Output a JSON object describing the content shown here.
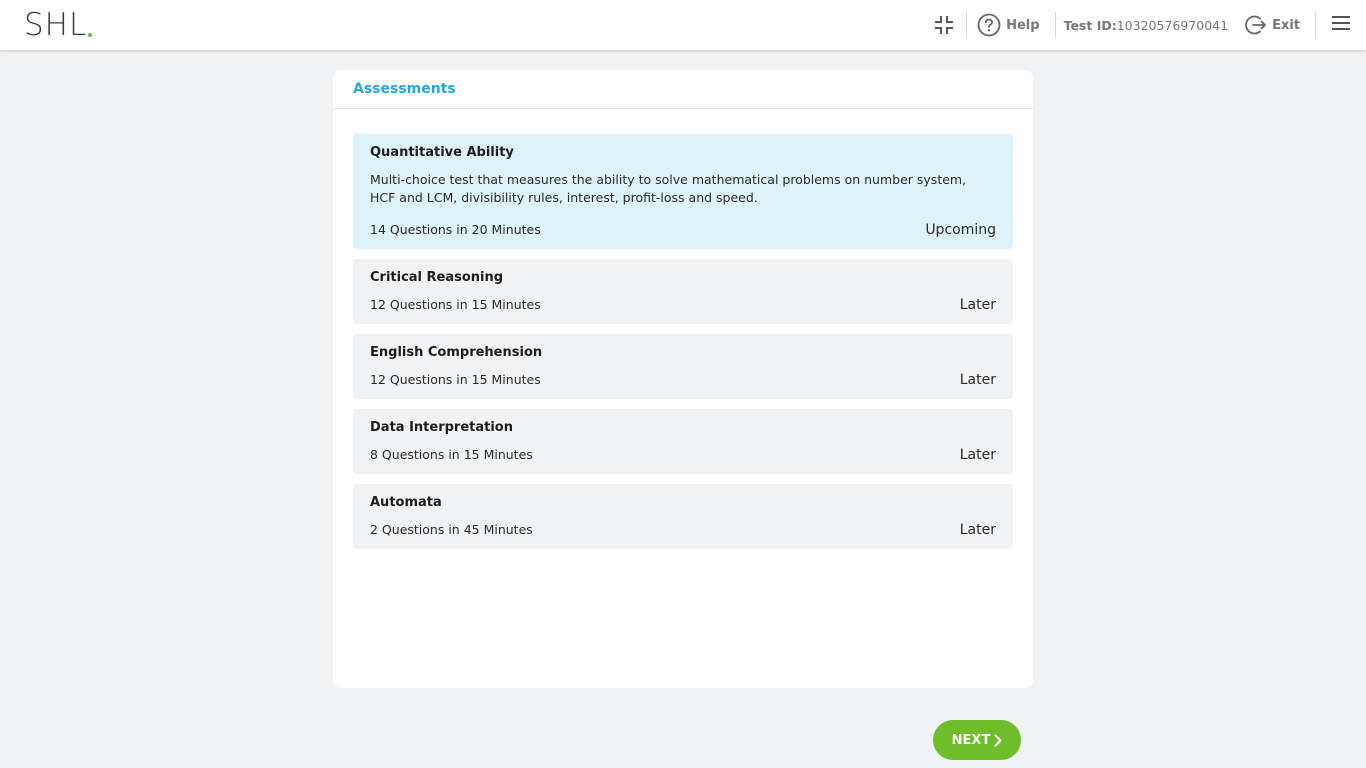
{
  "brand": {
    "logo_text": "SHL",
    "accent_color": "#6fba2c"
  },
  "header": {
    "collapse_icon": "collapse-icon",
    "help_icon": "help-circle-icon",
    "help_label": "Help",
    "test_id_label": "Test ID:",
    "test_id_value": "10320576970041",
    "exit_icon": "exit-icon",
    "exit_label": "Exit",
    "menu_icon": "hamburger-menu-icon"
  },
  "panel": {
    "title": "Assessments",
    "title_color": "#2aa6d6",
    "assessments": [
      {
        "name": "Quantitative Ability",
        "description": "Multi-choice test that measures the ability to solve mathematical problems on number system, HCF and LCM, divisibility rules, interest, profit-loss and speed.",
        "meta": "14 Questions in 20 Minutes",
        "status": "Upcoming"
      },
      {
        "name": "Critical Reasoning",
        "meta": "12 Questions in 15 Minutes",
        "status": "Later"
      },
      {
        "name": "English Comprehension",
        "meta": "12 Questions in 15 Minutes",
        "status": "Later"
      },
      {
        "name": "Data Interpretation",
        "meta": "8 Questions in 15 Minutes",
        "status": "Later"
      },
      {
        "name": "Automata",
        "meta": "2 Questions in 45 Minutes",
        "status": "Later"
      }
    ]
  },
  "footer": {
    "next_label": "NEXT",
    "next_icon": "chevron-right-icon",
    "next_color": "#6fbd2b"
  }
}
